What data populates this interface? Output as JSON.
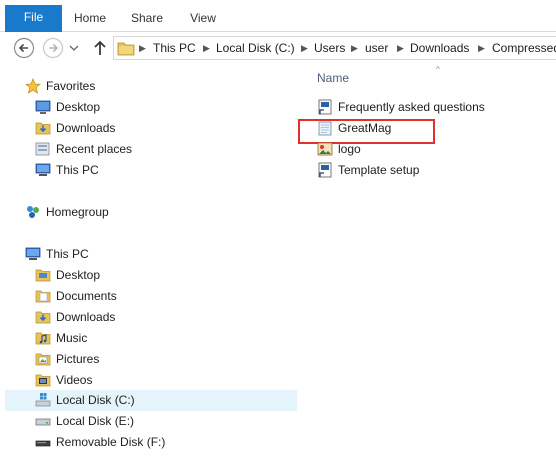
{
  "ribbon": {
    "tabs": [
      {
        "label": "File"
      },
      {
        "label": "Home"
      },
      {
        "label": "Share"
      },
      {
        "label": "View"
      }
    ]
  },
  "address": {
    "crumbs": [
      "This PC",
      "Local Disk (C:)",
      "Users",
      "user",
      "Downloads",
      "Compressed"
    ]
  },
  "navigation": {
    "favorites": {
      "label": "Favorites",
      "items": [
        {
          "label": "Desktop",
          "icon": "desktop-icon"
        },
        {
          "label": "Downloads",
          "icon": "downloads-folder-icon"
        },
        {
          "label": "Recent places",
          "icon": "recent-places-icon"
        },
        {
          "label": "This PC",
          "icon": "computer-icon"
        }
      ]
    },
    "homegroup": {
      "label": "Homegroup",
      "icon": "homegroup-icon"
    },
    "this_pc": {
      "label": "This PC",
      "items": [
        {
          "label": "Desktop",
          "icon": "folder-icon"
        },
        {
          "label": "Documents",
          "icon": "folder-icon"
        },
        {
          "label": "Downloads",
          "icon": "downloads-folder-icon"
        },
        {
          "label": "Music",
          "icon": "music-folder-icon"
        },
        {
          "label": "Pictures",
          "icon": "pictures-folder-icon"
        },
        {
          "label": "Videos",
          "icon": "videos-folder-icon"
        },
        {
          "label": "Local Disk (C:)",
          "icon": "windows-drive-icon",
          "selected": true
        },
        {
          "label": "Local Disk (E:)",
          "icon": "drive-icon"
        },
        {
          "label": "Removable Disk (F:)",
          "icon": "removable-drive-icon"
        }
      ]
    }
  },
  "content": {
    "column_header": "Name",
    "files": [
      {
        "name": "Frequently asked questions",
        "icon": "shortcut-file-icon"
      },
      {
        "name": "GreatMag",
        "icon": "text-file-icon",
        "highlighted": true
      },
      {
        "name": "logo",
        "icon": "image-file-icon"
      },
      {
        "name": "Template setup",
        "icon": "shortcut-file-icon"
      }
    ]
  },
  "colors": {
    "file_tab": "#1979ca",
    "highlight": "#e0312f",
    "selection": "#e5f3fb",
    "header_text": "#4c607a"
  }
}
